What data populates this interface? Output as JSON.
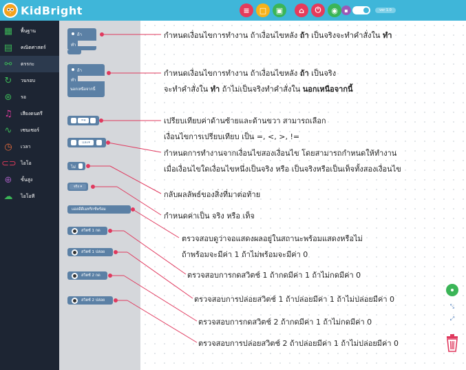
{
  "app": {
    "title": "KidBright",
    "version_label": "ver 1.0"
  },
  "toolbar": {
    "buttons": [
      {
        "name": "menu",
        "icon": "menu-icon",
        "color": "#e53b5b"
      },
      {
        "name": "new",
        "icon": "new-file-icon",
        "color": "#f6b21a"
      },
      {
        "name": "save",
        "icon": "save-icon",
        "color": "#3bb557"
      },
      {
        "name": "home",
        "icon": "home-icon",
        "color": "#e53b5b"
      },
      {
        "name": "upload",
        "icon": "upload-icon",
        "color": "#e53b5b"
      },
      {
        "name": "wifi",
        "icon": "wifi-icon",
        "color": "#3bb557"
      },
      {
        "name": "board",
        "icon": "board-icon",
        "color": "#9b59b6"
      }
    ]
  },
  "sidebar": {
    "items": [
      {
        "label": "พื้นฐาน",
        "icon": "grid-icon",
        "color": "#3bb557"
      },
      {
        "label": "คณิตศาสตร์",
        "icon": "calculator-icon",
        "color": "#3bb557"
      },
      {
        "label": "ตรรกะ",
        "icon": "logic-icon",
        "color": "#3bb557"
      },
      {
        "label": "วนรอบ",
        "icon": "loop-icon",
        "color": "#3bb557"
      },
      {
        "label": "รอ",
        "icon": "wait-icon",
        "color": "#3bb557"
      },
      {
        "label": "เสียงดนตรี",
        "icon": "music-icon",
        "color": "#e53ba0"
      },
      {
        "label": "เซนเซอร์",
        "icon": "sensor-icon",
        "color": "#3bb557"
      },
      {
        "label": "เวลา",
        "icon": "clock-icon",
        "color": "#e56b3b"
      },
      {
        "label": "ไอโอ",
        "icon": "io-icon",
        "color": "#e53b5b"
      },
      {
        "label": "ขั้นสูง",
        "icon": "advanced-icon",
        "color": "#9b59b6"
      },
      {
        "label": "ไอโอที",
        "icon": "iot-icon",
        "color": "#3bb557"
      }
    ]
  },
  "flyout": {
    "if_block": {
      "if_label": "ถ้า",
      "do_label": "ทำ"
    },
    "if_else_block": {
      "if_label": "ถ้า",
      "do_label": "ทำ",
      "else_label": "นอกเหนือจากนี้"
    },
    "compare_block": {
      "operator": "=▾"
    },
    "logic_op_block": {
      "operator": "และ▾"
    },
    "not_block": {
      "label": "ไม่"
    },
    "bool_block": {
      "label": "จริง ▾"
    },
    "display_ready_block": {
      "label": "แอลอีดีเมทริกซ์พร้อม"
    },
    "switch_blocks": [
      {
        "label": "สวิตช์ 1 กด"
      },
      {
        "label": "สวิตช์ 1 ปล่อย"
      },
      {
        "label": "สวิตช์ 2 กด"
      },
      {
        "label": "สวิตช์ 2 ปล่อย"
      }
    ]
  },
  "descriptions": [
    {
      "parts": [
        "กำหนดเงื่อนไขการทำงาน ถ้าเงื่อนไขหลัง ",
        "ถ้า",
        " เป็นจริงจะทำคำสั่งใน ",
        "ทำ",
        ""
      ]
    },
    {
      "parts": [
        "กำหนดเงื่อนไขการทำงาน ถ้าเงื่อนไขหลัง ",
        "ถ้า",
        " เป็นจริง",
        "",
        ""
      ]
    },
    {
      "parts": [
        "จะทำคำสั่งใน ",
        "ทำ",
        " ถ้าไม่เป็นจริงทำคำสั่งใน ",
        "นอกเหนือจากนี้",
        ""
      ]
    },
    {
      "parts": [
        "เปรียบเทียบค่าด้านซ้ายและด้านขวา สามารถเลือก",
        "",
        "",
        "",
        ""
      ]
    },
    {
      "parts": [
        "เงื่อนไขการเปรียบเทียบ เป็น =, <, >, !=",
        "",
        "",
        "",
        ""
      ]
    },
    {
      "parts": [
        "กำหนดการทำงานจากเงื่อนไขสองเงื่อนไข โดยสามารถกำหนดให้ทำงาน",
        "",
        "",
        "",
        ""
      ]
    },
    {
      "parts": [
        "เมื่อเงื่อนไขใดเงื่อนไขหนึ่งเป็นจริง หรือ เป็นจริงหรือเป็นเท็จทั้งสองเงื่อนไข",
        "",
        "",
        "",
        ""
      ]
    },
    {
      "parts": [
        "กลับผลลัพธ์ของสิ่งที่มาต่อท้าย",
        "",
        "",
        "",
        ""
      ]
    },
    {
      "parts": [
        "กำหนดค่าเป็น จริง หรือ เท็จ",
        "",
        "",
        "",
        ""
      ]
    },
    {
      "parts": [
        "ตรวจสอบดูว่าจอแสดงผลอยู่ในสถานะพร้อมแสดงหรือไม่",
        "",
        "",
        "",
        ""
      ]
    },
    {
      "parts": [
        "ถ้าพร้อมจะมีค่า 1 ถ้าไม่พร้อมจะมีค่า 0",
        "",
        "",
        "",
        ""
      ]
    },
    {
      "parts": [
        "ตรวจสอบการกดสวิตช์ 1 ถ้ากดมีค่า 1 ถ้าไม่กดมีค่า 0",
        "",
        "",
        "",
        ""
      ]
    },
    {
      "parts": [
        "ตรวจสอบการปล่อยสวิตช์ 1 ถ้าปล่อยมีค่า 1 ถ้าไม่ปล่อยมีค่า 0",
        "",
        "",
        "",
        ""
      ]
    },
    {
      "parts": [
        "ตรวจสอบการกดสวิตช์ 2 ถ้ากดมีค่า 1 ถ้าไม่กดมีค่า 0",
        "",
        "",
        "",
        ""
      ]
    },
    {
      "parts": [
        "ตรวจสอบการปล่อยสวิตช์ 2 ถ้าปล่อยมีค่า 1 ถ้าไม่ปล่อยมีค่า 0",
        "",
        "",
        "",
        ""
      ]
    }
  ],
  "workspace_controls": {
    "center_icon": "target-icon",
    "zoom_icon": "zoom-icon",
    "trash_icon": "trash-icon"
  }
}
